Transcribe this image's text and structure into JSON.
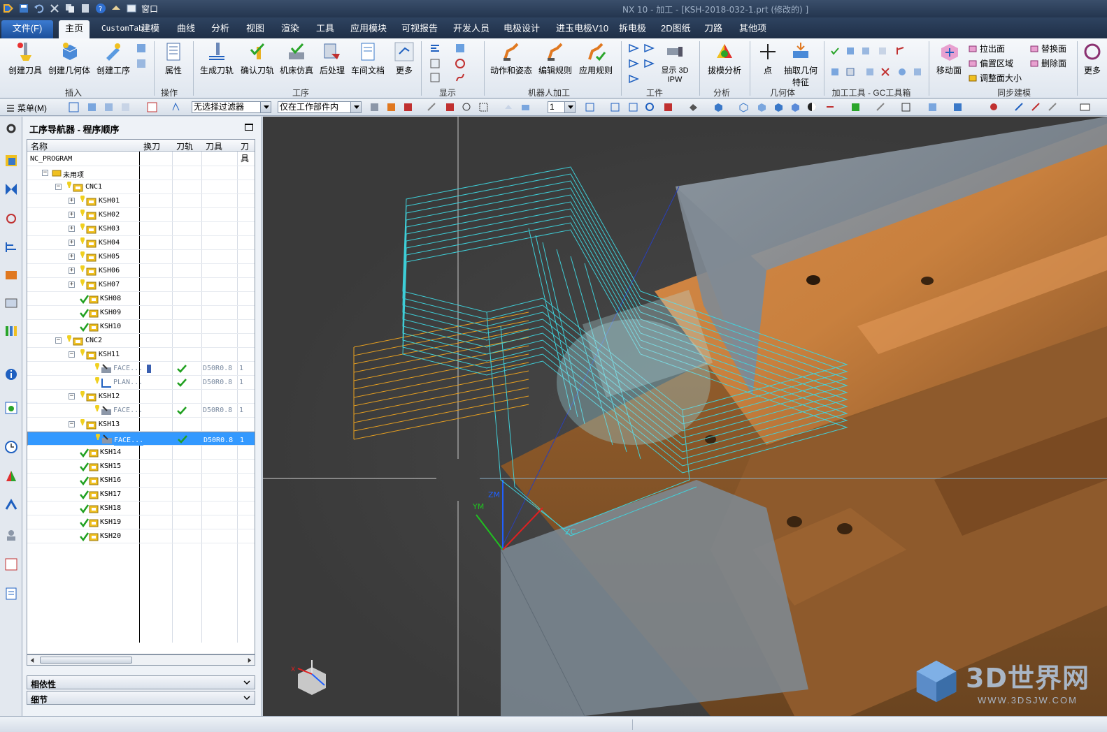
{
  "titlebar": {
    "title": "NX 10 - 加工 - [KSH-2018-032-1.prt (修改的) ]",
    "window_menu": "窗口"
  },
  "tabs": [
    "文件(F)",
    "主页",
    "CustomTab",
    "建模",
    "曲线",
    "分析",
    "视图",
    "渲染",
    "工具",
    "应用模块",
    "可视报告",
    "开发人员",
    "电极设计",
    "进玉电极V10",
    "拆电极",
    "2D图纸",
    "刀路",
    "其他项"
  ],
  "ribbon": {
    "insert": [
      "创建刀具",
      "创建几何体",
      "创建工序"
    ],
    "insert_label": "插入",
    "op": [
      "属性"
    ],
    "op_label": "操作",
    "process": [
      "生成刀轨",
      "确认刀轨",
      "机床仿真",
      "后处理",
      "车间文档",
      "更多"
    ],
    "process_label": "工序",
    "display_label": "显示",
    "robot": [
      "动作和姿态",
      "编辑规则",
      "应用规则"
    ],
    "robot_label": "机器人加工",
    "workpiece": "显示 3D IPW",
    "workpiece_label": "工件",
    "analysis": "拔模分析",
    "analysis_label": "分析",
    "point": "点",
    "extract": "抽取几何特征",
    "geometry_label": "几何体",
    "mfg_label": "加工工具 - GC工具箱",
    "move_face": "移动面",
    "sync": [
      "拉出面",
      "偏置区域",
      "调整面大小",
      "替换面",
      "删除面"
    ],
    "sync_label": "同步建模",
    "more_right": "更多"
  },
  "toolbar2": {
    "menu": "菜单(M)",
    "filter": "无选择过滤器",
    "scope": "仅在工作部件内",
    "layer": "1"
  },
  "navigator": {
    "title": "工序导航器 - 程序顺序",
    "columns": [
      "名称",
      "换刀",
      "刀轨",
      "刀具",
      "刀具"
    ],
    "rows": [
      {
        "name": "NC_PROGRAM",
        "indent": 0,
        "icon": "none",
        "exp": ""
      },
      {
        "name": "未用项",
        "indent": 1,
        "icon": "folder",
        "exp": "-"
      },
      {
        "name": "CNC1",
        "indent": 2,
        "icon": "program",
        "exp": "-"
      },
      {
        "name": "KSH01",
        "indent": 3,
        "icon": "program",
        "exp": "+"
      },
      {
        "name": "KSH02",
        "indent": 3,
        "icon": "program",
        "exp": "+"
      },
      {
        "name": "KSH03",
        "indent": 3,
        "icon": "program",
        "exp": "+"
      },
      {
        "name": "KSH04",
        "indent": 3,
        "icon": "program",
        "exp": "+"
      },
      {
        "name": "KSH05",
        "indent": 3,
        "icon": "program",
        "exp": "+"
      },
      {
        "name": "KSH06",
        "indent": 3,
        "icon": "program",
        "exp": "+"
      },
      {
        "name": "KSH07",
        "indent": 3,
        "icon": "program",
        "exp": "+"
      },
      {
        "name": "KSH08",
        "indent": 3,
        "icon": "check",
        "exp": ""
      },
      {
        "name": "KSH09",
        "indent": 3,
        "icon": "check",
        "exp": ""
      },
      {
        "name": "KSH10",
        "indent": 3,
        "icon": "check",
        "exp": ""
      },
      {
        "name": "CNC2",
        "indent": 2,
        "icon": "program",
        "exp": "-"
      },
      {
        "name": "KSH11",
        "indent": 3,
        "icon": "program",
        "exp": "-"
      },
      {
        "name": "FACE...",
        "indent": 4,
        "icon": "op",
        "exp": "",
        "change": true,
        "path": true,
        "tool": "D50R0.8",
        "tp": "1"
      },
      {
        "name": "PLAN...",
        "indent": 4,
        "icon": "op2",
        "exp": "",
        "path": true,
        "tool": "D50R0.8",
        "tp": "1"
      },
      {
        "name": "KSH12",
        "indent": 3,
        "icon": "program",
        "exp": "-"
      },
      {
        "name": "FACE...",
        "indent": 4,
        "icon": "op",
        "exp": "",
        "path": true,
        "tool": "D50R0.8",
        "tp": "1"
      },
      {
        "name": "KSH13",
        "indent": 3,
        "icon": "program",
        "exp": "-"
      },
      {
        "name": "FACE...",
        "indent": 4,
        "icon": "op",
        "exp": "",
        "path": true,
        "tool": "D50R0.8",
        "tp": "1",
        "selected": true
      },
      {
        "name": "KSH14",
        "indent": 3,
        "icon": "check",
        "exp": ""
      },
      {
        "name": "KSH15",
        "indent": 3,
        "icon": "check",
        "exp": ""
      },
      {
        "name": "KSH16",
        "indent": 3,
        "icon": "check",
        "exp": ""
      },
      {
        "name": "KSH17",
        "indent": 3,
        "icon": "check",
        "exp": ""
      },
      {
        "name": "KSH18",
        "indent": 3,
        "icon": "check",
        "exp": ""
      },
      {
        "name": "KSH19",
        "indent": 3,
        "icon": "check",
        "exp": ""
      },
      {
        "name": "KSH20",
        "indent": 3,
        "icon": "check",
        "exp": ""
      }
    ],
    "panels": [
      "相依性",
      "细节"
    ]
  },
  "viewport": {
    "axis_labels": [
      "ZM",
      "YM",
      "ZC",
      "X"
    ],
    "watermark_big": "3D世界网",
    "watermark_small": "WWW.3DSJW.COM"
  },
  "colors": {
    "accent": "#3399ff",
    "toolpath_cyan": "#3fd6e0",
    "toolpath_orange": "#e8a020",
    "part": "#b8773c"
  }
}
